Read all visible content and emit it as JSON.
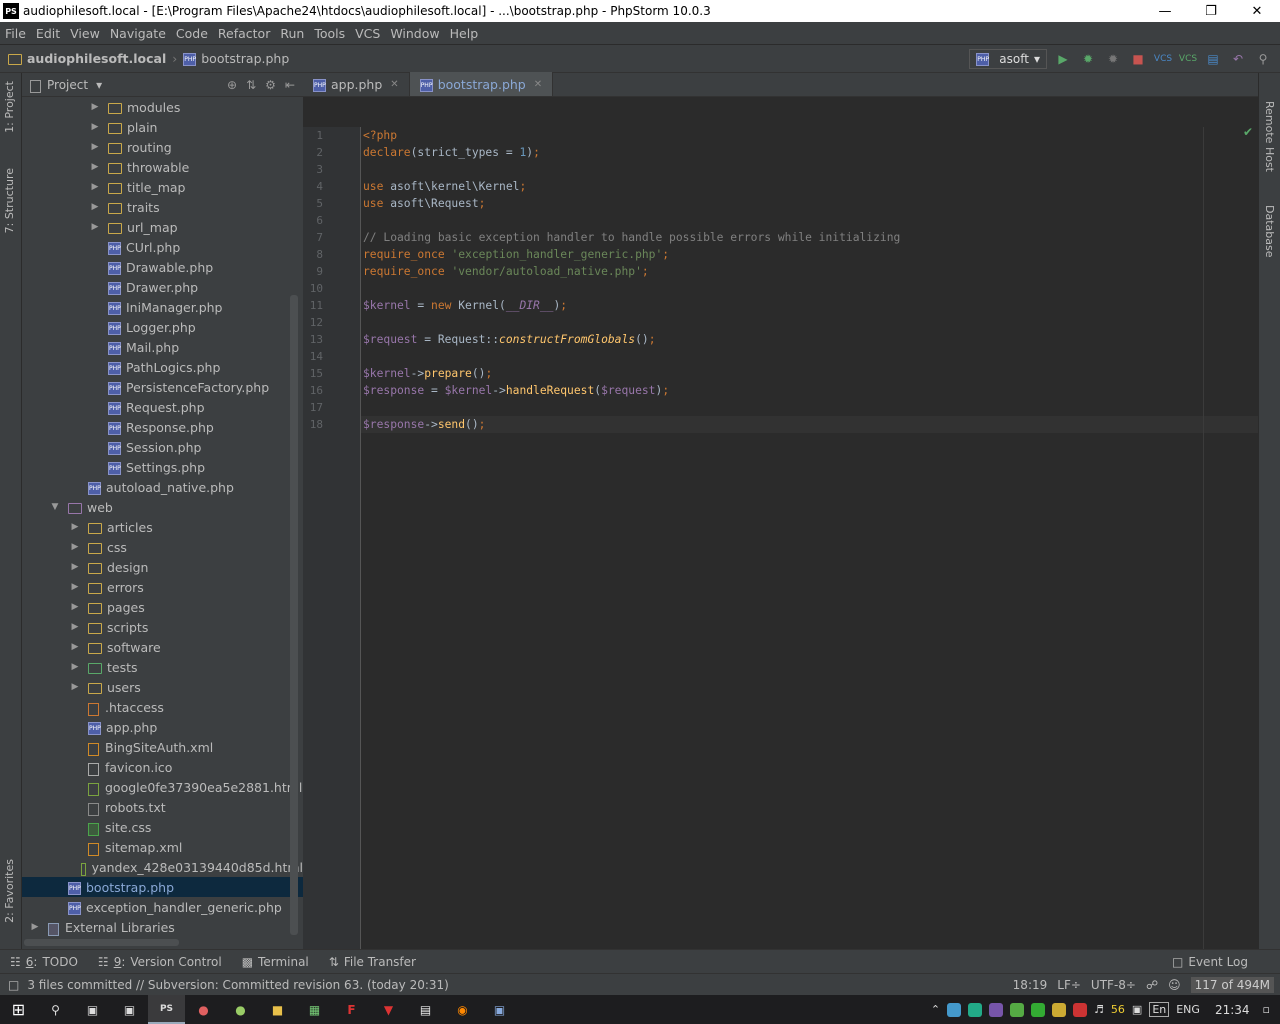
{
  "window": {
    "title": "audiophilesoft.local - [E:\\Program Files\\Apache24\\htdocs\\audiophilesoft.local] - ...\\bootstrap.php - PhpStorm 10.0.3",
    "app_icon": "PS"
  },
  "menu": [
    "File",
    "Edit",
    "View",
    "Navigate",
    "Code",
    "Refactor",
    "Run",
    "Tools",
    "VCS",
    "Window",
    "Help"
  ],
  "breadcrumb": {
    "project": "audiophilesoft.local",
    "file": "bootstrap.php"
  },
  "run_config": "asoft",
  "project_panel": {
    "title": "Project"
  },
  "tree": [
    {
      "label": "modules",
      "type": "folder",
      "depth": 3,
      "arrow": "collapsed"
    },
    {
      "label": "plain",
      "type": "folder",
      "depth": 3,
      "arrow": "collapsed"
    },
    {
      "label": "routing",
      "type": "folder",
      "depth": 3,
      "arrow": "collapsed"
    },
    {
      "label": "throwable",
      "type": "folder",
      "depth": 3,
      "arrow": "collapsed"
    },
    {
      "label": "title_map",
      "type": "folder",
      "depth": 3,
      "arrow": "collapsed"
    },
    {
      "label": "traits",
      "type": "folder",
      "depth": 3,
      "arrow": "collapsed"
    },
    {
      "label": "url_map",
      "type": "folder",
      "depth": 3,
      "arrow": "collapsed"
    },
    {
      "label": "CUrl.php",
      "type": "php",
      "depth": 3
    },
    {
      "label": "Drawable.php",
      "type": "php",
      "depth": 3
    },
    {
      "label": "Drawer.php",
      "type": "php",
      "depth": 3
    },
    {
      "label": "IniManager.php",
      "type": "php",
      "depth": 3
    },
    {
      "label": "Logger.php",
      "type": "php",
      "depth": 3
    },
    {
      "label": "Mail.php",
      "type": "php",
      "depth": 3
    },
    {
      "label": "PathLogics.php",
      "type": "php",
      "depth": 3
    },
    {
      "label": "PersistenceFactory.php",
      "type": "php",
      "depth": 3
    },
    {
      "label": "Request.php",
      "type": "php",
      "depth": 3
    },
    {
      "label": "Response.php",
      "type": "php",
      "depth": 3
    },
    {
      "label": "Session.php",
      "type": "php",
      "depth": 3
    },
    {
      "label": "Settings.php",
      "type": "php",
      "depth": 3
    },
    {
      "label": "autoload_native.php",
      "type": "php",
      "depth": 2
    },
    {
      "label": "web",
      "type": "folder",
      "depth": 1,
      "arrow": "expanded"
    },
    {
      "label": "articles",
      "type": "folder",
      "depth": 2,
      "arrow": "collapsed"
    },
    {
      "label": "css",
      "type": "folder",
      "depth": 2,
      "arrow": "collapsed"
    },
    {
      "label": "design",
      "type": "folder",
      "depth": 2,
      "arrow": "collapsed"
    },
    {
      "label": "errors",
      "type": "folder",
      "depth": 2,
      "arrow": "collapsed"
    },
    {
      "label": "pages",
      "type": "folder",
      "depth": 2,
      "arrow": "collapsed"
    },
    {
      "label": "scripts",
      "type": "folder",
      "depth": 2,
      "arrow": "collapsed"
    },
    {
      "label": "software",
      "type": "folder",
      "depth": 2,
      "arrow": "collapsed"
    },
    {
      "label": "tests",
      "type": "folder",
      "depth": 2,
      "arrow": "collapsed"
    },
    {
      "label": "users",
      "type": "folder",
      "depth": 2,
      "arrow": "collapsed"
    },
    {
      "label": ".htaccess",
      "type": "hta",
      "depth": 2
    },
    {
      "label": "app.php",
      "type": "php",
      "depth": 2
    },
    {
      "label": "BingSiteAuth.xml",
      "type": "xml",
      "depth": 2
    },
    {
      "label": "favicon.ico",
      "type": "ico",
      "depth": 2
    },
    {
      "label": "google0fe37390ea5e2881.html",
      "type": "html",
      "depth": 2
    },
    {
      "label": "robots.txt",
      "type": "txt",
      "depth": 2
    },
    {
      "label": "site.css",
      "type": "css",
      "depth": 2
    },
    {
      "label": "sitemap.xml",
      "type": "xml",
      "depth": 2
    },
    {
      "label": "yandex_428e03139440d85d.html",
      "type": "html",
      "depth": 2
    },
    {
      "label": "bootstrap.php",
      "type": "php",
      "depth": 1,
      "selected": true
    },
    {
      "label": "exception_handler_generic.php",
      "type": "php",
      "depth": 1
    },
    {
      "label": "External Libraries",
      "type": "lib",
      "depth": 0,
      "arrow": "collapsed"
    }
  ],
  "tabs": [
    {
      "label": "app.php",
      "active": false
    },
    {
      "label": "bootstrap.php",
      "active": true
    }
  ],
  "code_lines": [
    "<?php",
    "declare(strict_types = 1);",
    "",
    "use asoft\\kernel\\Kernel;",
    "use asoft\\Request;",
    "",
    "// Loading basic exception handler to handle possible errors while initializing",
    "require_once 'exception_handler_generic.php';",
    "require_once 'vendor/autoload_native.php';",
    "",
    "$kernel = new Kernel(__DIR__);",
    "",
    "$request = Request::constructFromGlobals();",
    "",
    "$kernel->prepare();",
    "$response = $kernel->handleRequest($request);",
    "",
    "$response->send();"
  ],
  "left_tabs": [
    "1: Project",
    "7: Structure",
    "2: Favorites"
  ],
  "right_tabs": [
    "Remote Host",
    "Database"
  ],
  "tool_windows": [
    {
      "num": "6",
      "label": "TODO"
    },
    {
      "num": "9",
      "label": "Version Control"
    },
    {
      "num": "",
      "label": "Terminal"
    },
    {
      "num": "",
      "label": "File Transfer"
    }
  ],
  "event_log": "Event Log",
  "status": {
    "message": "3 files committed // Subversion: Committed revision 63. (today 20:31)",
    "position": "18:19",
    "line_sep": "LF÷",
    "encoding": "UTF-8÷",
    "memory": "117 of 494M"
  },
  "taskbar": {
    "lang": "ENG",
    "time": "21:34",
    "kbd": "En",
    "num": "56"
  }
}
